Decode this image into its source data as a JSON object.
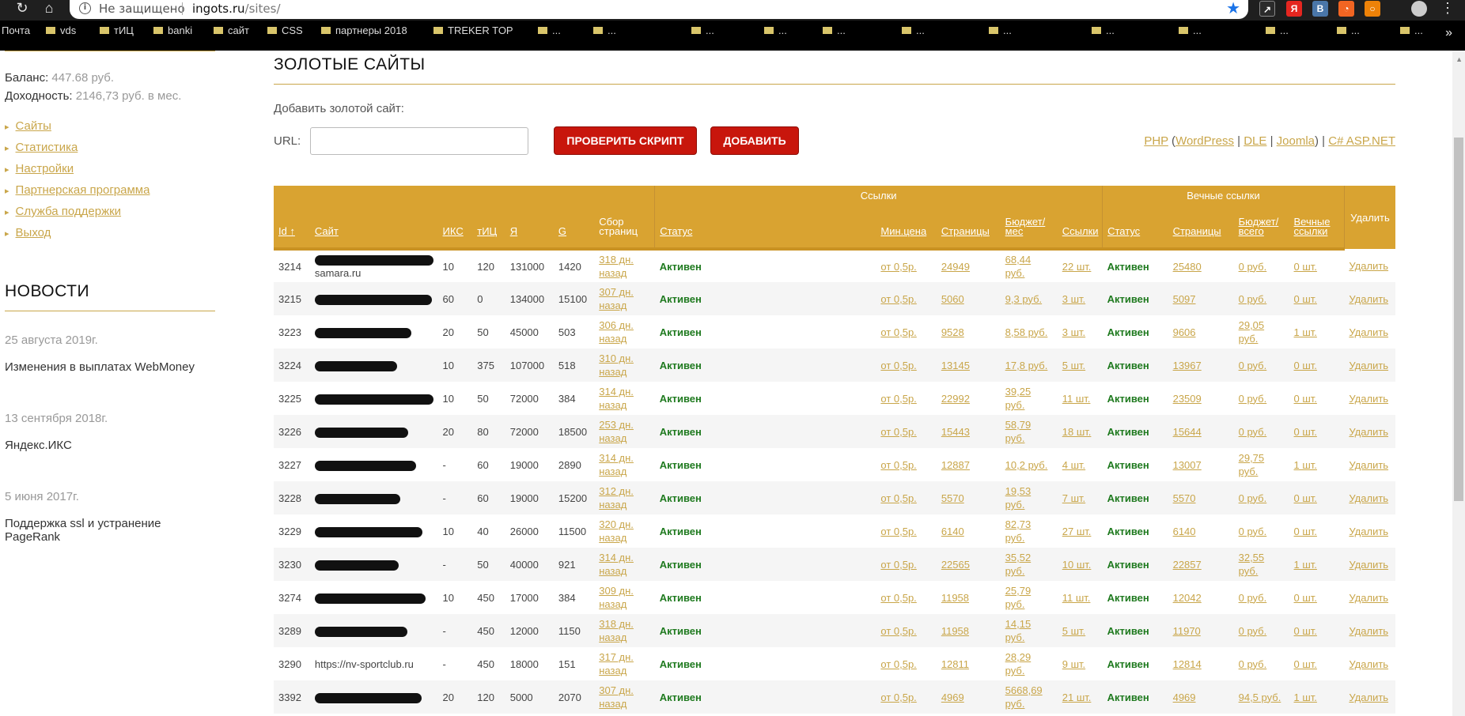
{
  "browser": {
    "not_secure": "Не защищено",
    "url_host": "ingots.ru",
    "url_path": "/sites/",
    "bookmarks": [
      "Почта",
      "vds",
      "тИЦ",
      "banki",
      "сайт",
      "CSS",
      "партнеры 2018",
      "TREKER TOP",
      "...",
      "...",
      "...",
      "...",
      "...",
      "...",
      "...",
      "...",
      "...",
      "...",
      "...",
      "..."
    ]
  },
  "sidebar": {
    "balance_label": "Баланс:",
    "balance_value": "447.68 руб.",
    "income_label": "Доходность:",
    "income_value": "2146,73 руб. в мес.",
    "menu": [
      "Сайты",
      "Статистика",
      "Настройки",
      "Партнерская программа",
      "Служба поддержки",
      "Выход"
    ],
    "news_title": "НОВОСТИ",
    "news": [
      {
        "date": "25 августа 2019г.",
        "text": "Изменения в выплатах WebMoney"
      },
      {
        "date": "13 сентября 2018г.",
        "text": "Яндекс.ИКС"
      },
      {
        "date": "5 июня 2017г.",
        "text": "Поддержка ssl и устранение PageRank"
      }
    ]
  },
  "main": {
    "title": "ЗОЛОТЫЕ САЙТЫ",
    "add_label": "Добавить золотой сайт:",
    "url_label": "URL:",
    "url_value": "",
    "check_button": "ПРОВЕРИТЬ СКРИПТ",
    "add_button": "ДОБАВИТЬ",
    "cms": {
      "php": "PHP",
      "open": " (",
      "wordpress": "WordPress",
      "sep1": " | ",
      "dle": "DLE",
      "sep2": " | ",
      "joomla": "Joomla",
      "close": ") | ",
      "aspnet": "C# ASP.NET"
    }
  },
  "table": {
    "group_links": "Ссылки",
    "group_eternal": "Вечные ссылки",
    "headers": {
      "id": "Id ↑",
      "site": "Сайт",
      "iks": "ИКС",
      "tic": "тИЦ",
      "ya": "Я",
      "g": "G",
      "collect": "Сбор страниц",
      "status": "Статус",
      "minprice": "Мин.цена",
      "pages": "Страницы",
      "budget": "Бюджет/ мес",
      "links": "Ссылки",
      "e_status": "Статус",
      "e_pages": "Страницы",
      "e_budget": "Бюджет/ всего",
      "e_links": "Вечные ссылки",
      "delete": "Удалить"
    },
    "rows": [
      {
        "id": "3214",
        "site": "samara.ru",
        "iks": "10",
        "tic": "120",
        "ya": "131000",
        "g": "1420",
        "collect": "318 дн. назад",
        "status": "Активен",
        "minprice": "от 0,5р.",
        "pages": "24949",
        "budget": "68,44 руб.",
        "links": "22 шт.",
        "e_status": "Активен",
        "e_pages": "25480",
        "e_budget": "0 руб.",
        "e_links": "0 шт.",
        "delete": "Удалить"
      },
      {
        "id": "3215",
        "site": "",
        "iks": "60",
        "tic": "0",
        "ya": "134000",
        "g": "15100",
        "collect": "307 дн. назад",
        "status": "Активен",
        "minprice": "от 0,5р.",
        "pages": "5060",
        "budget": "9,3 руб.",
        "links": "3 шт.",
        "e_status": "Активен",
        "e_pages": "5097",
        "e_budget": "0 руб.",
        "e_links": "0 шт.",
        "delete": "Удалить"
      },
      {
        "id": "3223",
        "site": "",
        "iks": "20",
        "tic": "50",
        "ya": "45000",
        "g": "503",
        "collect": "306 дн. назад",
        "status": "Активен",
        "minprice": "от 0,5р.",
        "pages": "9528",
        "budget": "8,58 руб.",
        "links": "3 шт.",
        "e_status": "Активен",
        "e_pages": "9606",
        "e_budget": "29,05 руб.",
        "e_links": "1 шт.",
        "delete": "Удалить"
      },
      {
        "id": "3224",
        "site": "",
        "iks": "10",
        "tic": "375",
        "ya": "107000",
        "g": "518",
        "collect": "310 дн. назад",
        "status": "Активен",
        "minprice": "от 0,5р.",
        "pages": "13145",
        "budget": "17,8 руб.",
        "links": "5 шт.",
        "e_status": "Активен",
        "e_pages": "13967",
        "e_budget": "0 руб.",
        "e_links": "0 шт.",
        "delete": "Удалить"
      },
      {
        "id": "3225",
        "site": "",
        "iks": "10",
        "tic": "50",
        "ya": "72000",
        "g": "384",
        "collect": "314 дн. назад",
        "status": "Активен",
        "minprice": "от 0,5р.",
        "pages": "22992",
        "budget": "39,25 руб.",
        "links": "11 шт.",
        "e_status": "Активен",
        "e_pages": "23509",
        "e_budget": "0 руб.",
        "e_links": "0 шт.",
        "delete": "Удалить"
      },
      {
        "id": "3226",
        "site": "",
        "iks": "20",
        "tic": "80",
        "ya": "72000",
        "g": "18500",
        "collect": "253 дн. назад",
        "status": "Активен",
        "minprice": "от 0,5р.",
        "pages": "15443",
        "budget": "58,79 руб.",
        "links": "18 шт.",
        "e_status": "Активен",
        "e_pages": "15644",
        "e_budget": "0 руб.",
        "e_links": "0 шт.",
        "delete": "Удалить"
      },
      {
        "id": "3227",
        "site": "",
        "iks": "-",
        "tic": "60",
        "ya": "19000",
        "g": "2890",
        "collect": "314 дн. назад",
        "status": "Активен",
        "minprice": "от 0,5р.",
        "pages": "12887",
        "budget": "10,2 руб.",
        "links": "4 шт.",
        "e_status": "Активен",
        "e_pages": "13007",
        "e_budget": "29,75 руб.",
        "e_links": "1 шт.",
        "delete": "Удалить"
      },
      {
        "id": "3228",
        "site": "",
        "iks": "-",
        "tic": "60",
        "ya": "19000",
        "g": "15200",
        "collect": "312 дн. назад",
        "status": "Активен",
        "minprice": "от 0,5р.",
        "pages": "5570",
        "budget": "19,53 руб.",
        "links": "7 шт.",
        "e_status": "Активен",
        "e_pages": "5570",
        "e_budget": "0 руб.",
        "e_links": "0 шт.",
        "delete": "Удалить"
      },
      {
        "id": "3229",
        "site": "",
        "iks": "10",
        "tic": "40",
        "ya": "26000",
        "g": "11500",
        "collect": "320 дн. назад",
        "status": "Активен",
        "minprice": "от 0,5р.",
        "pages": "6140",
        "budget": "82,73 руб.",
        "links": "27 шт.",
        "e_status": "Активен",
        "e_pages": "6140",
        "e_budget": "0 руб.",
        "e_links": "0 шт.",
        "delete": "Удалить"
      },
      {
        "id": "3230",
        "site": "",
        "iks": "-",
        "tic": "50",
        "ya": "40000",
        "g": "921",
        "collect": "314 дн. назад",
        "status": "Активен",
        "minprice": "от 0,5р.",
        "pages": "22565",
        "budget": "35,52 руб.",
        "links": "10 шт.",
        "e_status": "Активен",
        "e_pages": "22857",
        "e_budget": "32,55 руб.",
        "e_links": "1 шт.",
        "delete": "Удалить"
      },
      {
        "id": "3274",
        "site": "",
        "iks": "10",
        "tic": "450",
        "ya": "17000",
        "g": "384",
        "collect": "309 дн. назад",
        "status": "Активен",
        "minprice": "от 0,5р.",
        "pages": "11958",
        "budget": "25,79 руб.",
        "links": "11 шт.",
        "e_status": "Активен",
        "e_pages": "12042",
        "e_budget": "0 руб.",
        "e_links": "0 шт.",
        "delete": "Удалить"
      },
      {
        "id": "3289",
        "site": "",
        "iks": "-",
        "tic": "450",
        "ya": "12000",
        "g": "1150",
        "collect": "318 дн. назад",
        "status": "Активен",
        "minprice": "от 0,5р.",
        "pages": "11958",
        "budget": "14,15 руб.",
        "links": "5 шт.",
        "e_status": "Активен",
        "e_pages": "11970",
        "e_budget": "0 руб.",
        "e_links": "0 шт.",
        "delete": "Удалить"
      },
      {
        "id": "3290",
        "site": "https://nv-sportclub.ru",
        "iks": "-",
        "tic": "450",
        "ya": "18000",
        "g": "151",
        "collect": "317 дн. назад",
        "status": "Активен",
        "minprice": "от 0,5р.",
        "pages": "12811",
        "budget": "28,29 руб.",
        "links": "9 шт.",
        "e_status": "Активен",
        "e_pages": "12814",
        "e_budget": "0 руб.",
        "e_links": "0 шт.",
        "delete": "Удалить"
      },
      {
        "id": "3392",
        "site": "",
        "iks": "20",
        "tic": "120",
        "ya": "5000",
        "g": "2070",
        "collect": "307 дн. назад",
        "status": "Активен",
        "minprice": "от 0,5р.",
        "pages": "4969",
        "budget": "5668,69 руб.",
        "links": "21 шт.",
        "e_status": "Активен",
        "e_pages": "4969",
        "e_budget": "94,5 руб.",
        "e_links": "1 шт.",
        "delete": "Удалить"
      }
    ]
  }
}
